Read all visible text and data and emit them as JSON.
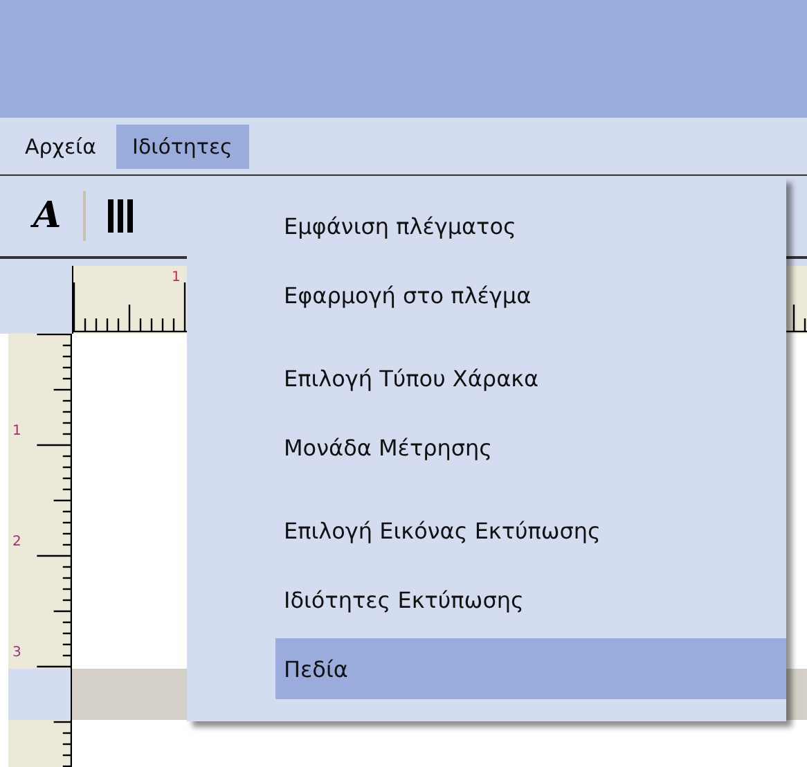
{
  "menubar": [
    {
      "label": "Αρχεία",
      "selected": false
    },
    {
      "label": "Ιδιότητες",
      "selected": true
    }
  ],
  "toolbar": {
    "text_glyph": "A"
  },
  "ruler": {
    "horizontal_labels": [
      "1"
    ],
    "vertical_labels": [
      "1",
      "2",
      "3"
    ]
  },
  "menu": [
    {
      "kind": "item",
      "label": "Εμφάνιση πλέγματος",
      "selected": false
    },
    {
      "kind": "item",
      "label": "Εφαρμογή στο πλέγμα",
      "selected": false
    },
    {
      "kind": "separator"
    },
    {
      "kind": "item",
      "label": "Επιλογή Τύπου Χάρακα",
      "selected": false
    },
    {
      "kind": "item",
      "label": "Μονάδα Μέτρησης",
      "selected": false
    },
    {
      "kind": "separator"
    },
    {
      "kind": "item",
      "label": "Επιλογή Εικόνας Εκτύπωσης",
      "selected": false
    },
    {
      "kind": "item",
      "label": "Ιδιότητες Εκτύπωσης",
      "selected": false
    },
    {
      "kind": "item",
      "label": "Πεδία",
      "selected": true
    }
  ]
}
